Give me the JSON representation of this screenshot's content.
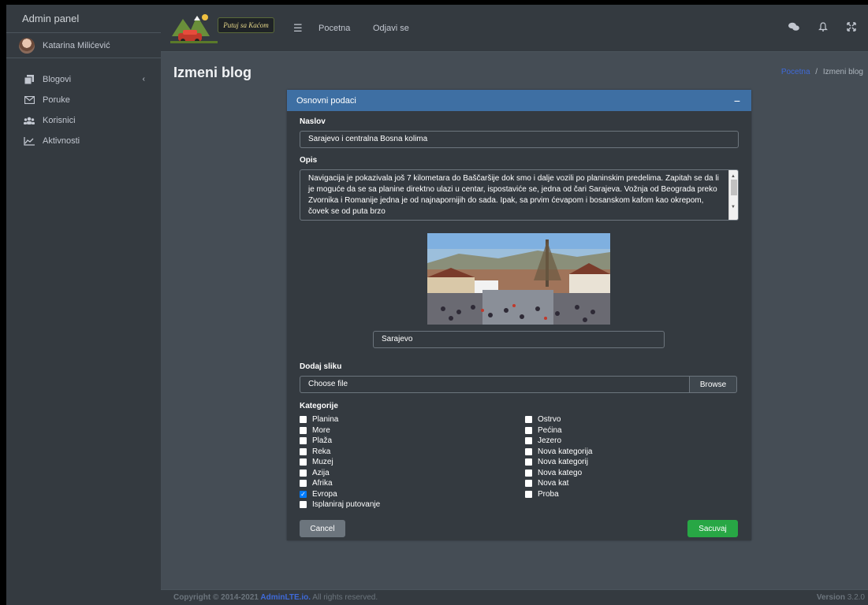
{
  "sidebar": {
    "brand": "Admin panel",
    "user_name": "Katarina Milićević",
    "items": [
      {
        "label": "Blogovi",
        "icon": "copy-icon"
      },
      {
        "label": "Poruke",
        "icon": "envelope-icon"
      },
      {
        "label": "Korisnici",
        "icon": "users-icon"
      },
      {
        "label": "Aktivnosti",
        "icon": "chart-line-icon"
      }
    ]
  },
  "topbar": {
    "logo_text": "Putuj sa Kaćom",
    "links": [
      "Pocetna",
      "Odjavi se"
    ],
    "icons": [
      "comments-icon",
      "bell-icon",
      "expand-icon"
    ]
  },
  "header": {
    "title": "Izmeni blog",
    "breadcrumb_home": "Pocetna",
    "breadcrumb_sep": "/",
    "breadcrumb_current": "Izmeni blog"
  },
  "card": {
    "title": "Osnovni podaci",
    "collapse": "−",
    "naslov_label": "Naslov",
    "naslov_value": "Sarajevo i centralna Bosna kolima",
    "opis_label": "Opis",
    "opis_value": "Navigacija je pokazivala još 7 kilometara do Baščaršije dok smo i dalje vozili po planinskim predelima. Zapitah se da li je moguće da se sa planine direktno ulazi u centar, ispostaviće se, jedna od čari Sarajeva. Vožnja od Beograda preko Zvornika i Romanije jedna je od najnapornijih do sada. Ipak, sa prvim ćevapom i bosanskom kafom kao okrepom, čovek se od puta brzo",
    "image_caption": "Sarajevo",
    "dodaj_label": "Dodaj sliku",
    "file_placeholder": "Choose file",
    "browse_label": "Browse",
    "kategorije_label": "Kategorije",
    "categories_left": [
      {
        "label": "Planina",
        "checked": false
      },
      {
        "label": "More",
        "checked": false
      },
      {
        "label": "Plaža",
        "checked": false
      },
      {
        "label": "Reka",
        "checked": false
      },
      {
        "label": "Muzej",
        "checked": false
      },
      {
        "label": "Azija",
        "checked": false
      },
      {
        "label": "Afrika",
        "checked": false
      },
      {
        "label": "Evropa",
        "checked": true
      },
      {
        "label": "Isplaniraj putovanje",
        "checked": false
      }
    ],
    "categories_right": [
      {
        "label": "Ostrvo",
        "checked": false
      },
      {
        "label": "Pećina",
        "checked": false
      },
      {
        "label": "Jezero",
        "checked": false
      },
      {
        "label": "Nova kategorija",
        "checked": false
      },
      {
        "label": "Nova kategorij",
        "checked": false
      },
      {
        "label": "Nova katego",
        "checked": false
      },
      {
        "label": "Nova kat",
        "checked": false
      },
      {
        "label": "Proba",
        "checked": false
      }
    ],
    "cancel_label": "Cancel",
    "save_label": "Sacuvaj"
  },
  "footer": {
    "copyright_prefix": "Copyright © 2014-2021 ",
    "copyright_link": "AdminLTE.io.",
    "copyright_suffix": " All rights reserved.",
    "version_label": "Version",
    "version_number": "3.2.0"
  },
  "colors": {
    "card_header": "#3e6fa3",
    "save_button": "#28a745",
    "cancel_button": "#6c757d",
    "link": "#3f6ad8"
  }
}
